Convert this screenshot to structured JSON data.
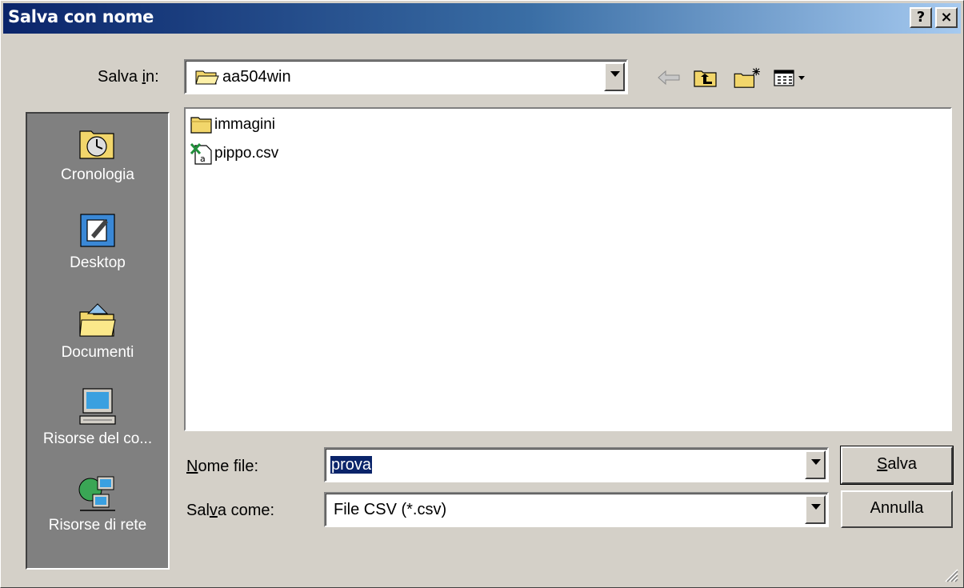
{
  "window": {
    "title": "Salva con nome",
    "help_button": "?",
    "close_button": "×"
  },
  "toolbar": {
    "save_in_label_pre": "Salva ",
    "save_in_label_ul": "i",
    "save_in_label_post": "n:",
    "current_folder": "aa504win",
    "icons": [
      "back-arrow-icon",
      "up-folder-icon",
      "new-folder-icon",
      "view-menu-icon"
    ]
  },
  "places_bar": [
    {
      "label": "Cronologia",
      "icon": "history-icon"
    },
    {
      "label": "Desktop",
      "icon": "desktop-icon"
    },
    {
      "label": "Documenti",
      "icon": "documents-icon"
    },
    {
      "label": "Risorse del co...",
      "icon": "my-computer-icon"
    },
    {
      "label": "Risorse di rete",
      "icon": "network-icon"
    }
  ],
  "files": [
    {
      "name": "immagini",
      "type": "folder"
    },
    {
      "name": "pippo.csv",
      "type": "csv"
    }
  ],
  "filename": {
    "label_ul": "N",
    "label_rest": "ome file:",
    "value": "prova"
  },
  "filetype": {
    "label_pre": "Sal",
    "label_ul": "v",
    "label_post": "a come:",
    "value": "File CSV  (*.csv)"
  },
  "buttons": {
    "save_ul": "S",
    "save_rest": "alva",
    "cancel": "Annulla"
  },
  "colors": {
    "title_start": "#0a246a",
    "title_end": "#a6caf0",
    "face": "#d4d0c8",
    "places_bg": "#808080"
  }
}
